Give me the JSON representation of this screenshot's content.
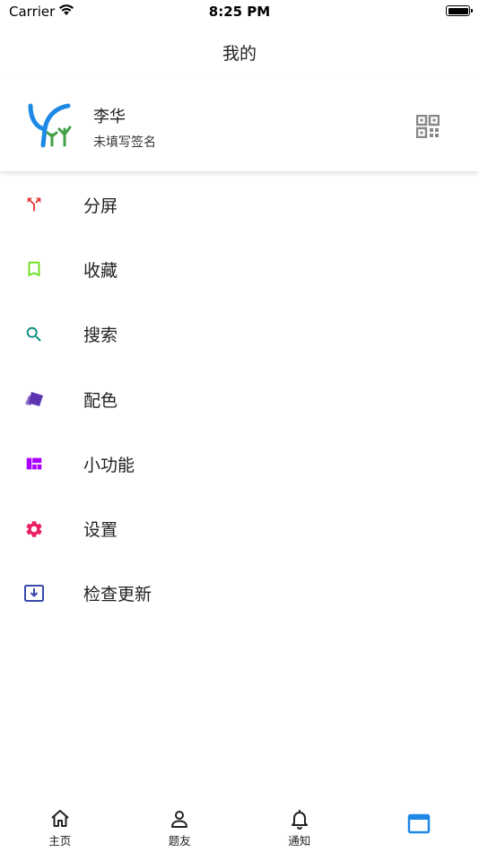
{
  "status_bar": {
    "carrier": "Carrier",
    "time": "8:25 PM",
    "battery_level": 1.0
  },
  "nav": {
    "title": "我的"
  },
  "profile": {
    "name": "李华",
    "signature": "未填写签名",
    "avatar_icon": "tree-logo-icon",
    "qr_icon": "qr-code-icon"
  },
  "menu": {
    "items": [
      {
        "label": "分屏",
        "icon": "split-icon",
        "color": "#e53935"
      },
      {
        "label": "收藏",
        "icon": "bookmark-icon",
        "color": "#64dd17"
      },
      {
        "label": "搜索",
        "icon": "search-icon",
        "color": "#00897b"
      },
      {
        "label": "配色",
        "icon": "palette-cards-icon",
        "color": "#5e35b1"
      },
      {
        "label": "小功能",
        "icon": "dashboard-icon",
        "color": "#aa00ff"
      },
      {
        "label": "设置",
        "icon": "gear-icon",
        "color": "#e91e63"
      },
      {
        "label": "检查更新",
        "icon": "download-box-icon",
        "color": "#3949ab"
      }
    ]
  },
  "tabbar": {
    "tabs": [
      {
        "label": "主页",
        "icon": "home-icon"
      },
      {
        "label": "题友",
        "icon": "person-icon"
      },
      {
        "label": "通知",
        "icon": "bell-icon"
      },
      {
        "label": "",
        "icon": "window-icon",
        "active": true
      }
    ],
    "active_color": "#1e88e5"
  }
}
